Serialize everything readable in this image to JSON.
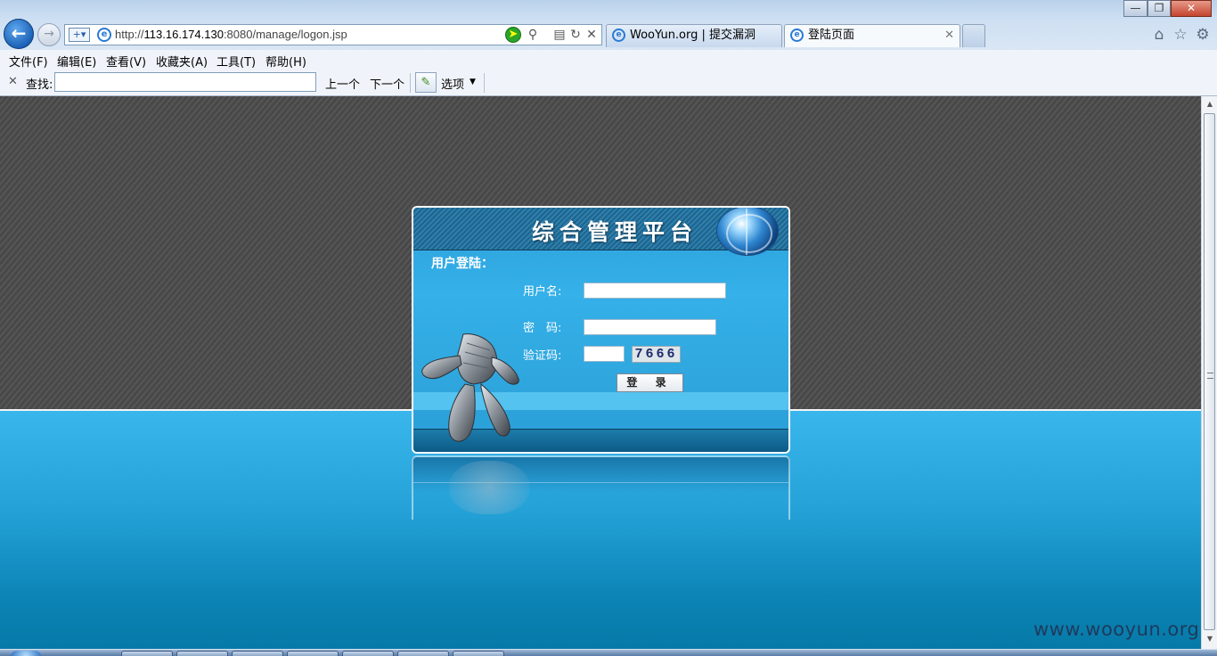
{
  "browser": {
    "url_prefix": "http://",
    "url_host": "113.16.174.130",
    "url_rest": ":8080/manage/logon.jsp",
    "tabs": [
      {
        "label": "WooYun.org | 提交漏洞",
        "active": false
      },
      {
        "label": "登陆页面",
        "active": true
      }
    ]
  },
  "menu": [
    "文件(F)",
    "编辑(E)",
    "查看(V)",
    "收藏夹(A)",
    "工具(T)",
    "帮助(H)"
  ],
  "findbar": {
    "label": "查找:",
    "value": "",
    "prev_label": "上一个",
    "next_label": "下一个",
    "options_label": "选项"
  },
  "login": {
    "title": "综合管理平台",
    "subtitle": "用户登陆：",
    "username_label": "用户名:",
    "username_value": "",
    "password_label": "密　码:",
    "password_value": "",
    "captcha_label": "验证码:",
    "captcha_value": "",
    "captcha_code": "7666",
    "submit_label": "登 录"
  },
  "watermark": "www.wooyun.org",
  "colors": {
    "page_dark": "#4d4d4d",
    "page_blue": "#25a3d9",
    "panel_blue": "#35b0e8",
    "header_blue": "#1c6f9e"
  },
  "icons": [
    "back-arrow-icon",
    "forward-arrow-icon",
    "ie-icon",
    "search-icon",
    "refresh-icon",
    "stop-icon",
    "home-icon",
    "favorites-star-icon",
    "tools-gear-icon",
    "globe-icon",
    "pencil-icon"
  ]
}
